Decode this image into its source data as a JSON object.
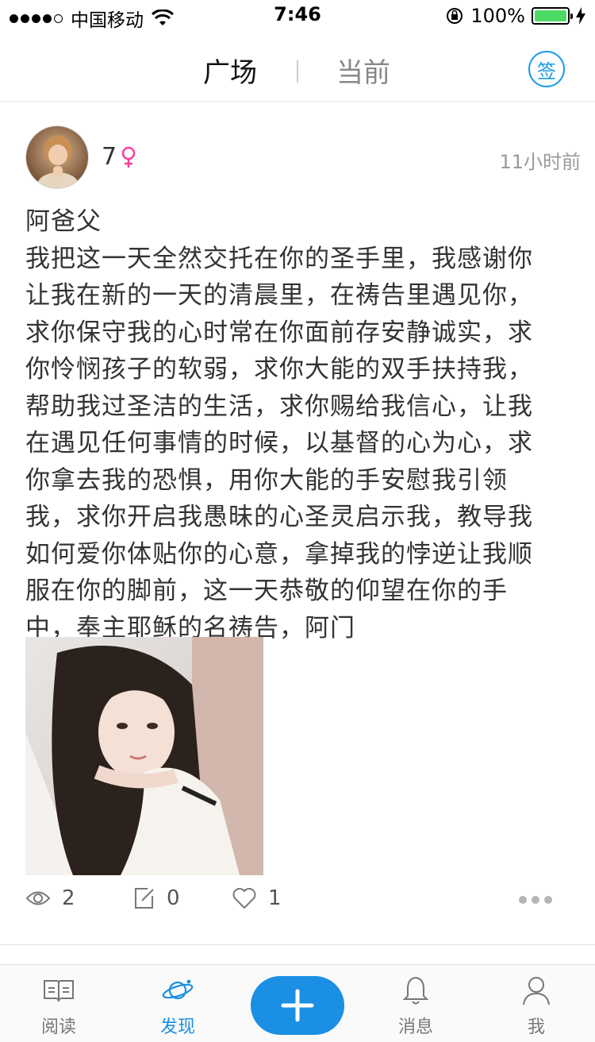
{
  "status_bar": {
    "carrier": "中国移动",
    "time": "7:46",
    "battery": "100%",
    "battery_level": 1.0
  },
  "top_nav": {
    "tabs": [
      {
        "label": "广场",
        "active": true
      },
      {
        "label": "当前",
        "active": false
      }
    ],
    "sign_in_label": "签"
  },
  "post": {
    "username": "7",
    "gender": "female",
    "time": "11小时前",
    "lines": [
      "阿爸父",
      "我把这一天全然交托在你的圣手里，我感谢你",
      "让我在新的一天的清晨里，在祷告里遇见你，",
      "求你保守我的心时常在你面前存安静诚实，求",
      "你怜悯孩子的软弱，求你大能的双手扶持我，",
      "帮助我过圣洁的生活，求你赐给我信心，让我",
      "在遇见任何事情的时候，以基督的心为心，求",
      "你拿去我的恐惧，用你大能的手安慰我引领",
      "我，求你开启我愚昧的心圣灵启示我，教导我",
      "如何爱你体贴你的心意，拿掉我的悖逆让我顺",
      "服在你的脚前，这一天恭敬的仰望在你的手",
      "中，奉主耶稣的名祷告，阿门"
    ],
    "views": "2",
    "comments": "0",
    "likes": "1"
  },
  "tab_bar": {
    "items": [
      {
        "label": "阅读",
        "icon": "book-icon"
      },
      {
        "label": "发现",
        "icon": "planet-icon",
        "active": true
      },
      {
        "label": "",
        "icon": "plus-icon"
      },
      {
        "label": "消息",
        "icon": "bell-icon"
      },
      {
        "label": "我",
        "icon": "person-icon"
      }
    ]
  },
  "colors": {
    "accent": "#1a8fe3",
    "female": "#ff3ba0",
    "battery": "#4cd964"
  }
}
